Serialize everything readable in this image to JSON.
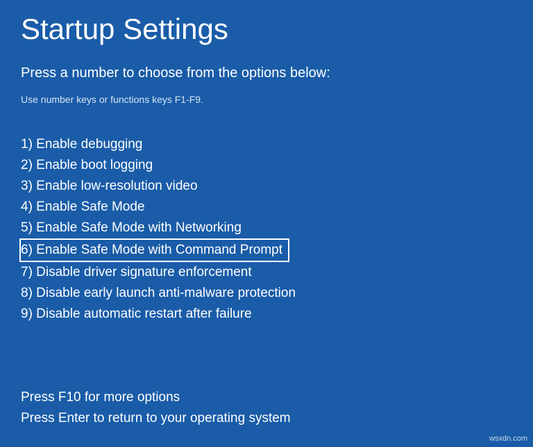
{
  "title": "Startup Settings",
  "subtitle": "Press a number to choose from the options below:",
  "instruction": "Use number keys or functions keys F1-F9.",
  "options": [
    {
      "num": "1",
      "label": "Enable debugging",
      "highlighted": false
    },
    {
      "num": "2",
      "label": "Enable boot logging",
      "highlighted": false
    },
    {
      "num": "3",
      "label": "Enable low-resolution video",
      "highlighted": false
    },
    {
      "num": "4",
      "label": "Enable Safe Mode",
      "highlighted": false
    },
    {
      "num": "5",
      "label": "Enable Safe Mode with Networking",
      "highlighted": false
    },
    {
      "num": "6",
      "label": "Enable Safe Mode with Command Prompt",
      "highlighted": true
    },
    {
      "num": "7",
      "label": "Disable driver signature enforcement",
      "highlighted": false
    },
    {
      "num": "8",
      "label": "Disable early launch anti-malware protection",
      "highlighted": false
    },
    {
      "num": "9",
      "label": "Disable automatic restart after failure",
      "highlighted": false
    }
  ],
  "footer": {
    "more": "Press F10 for more options",
    "return": "Press Enter to return to your operating system"
  },
  "watermark": "wsxdn.com"
}
